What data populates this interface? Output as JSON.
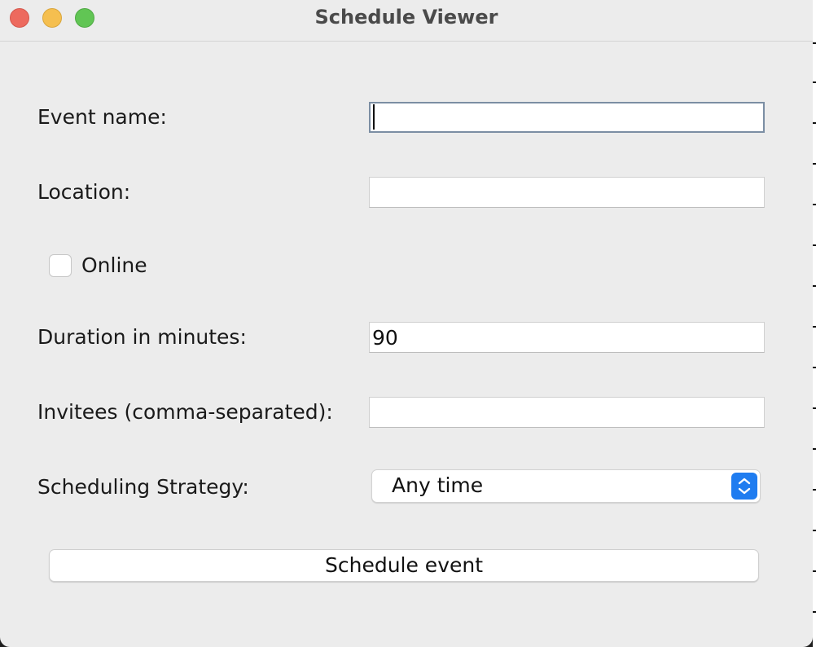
{
  "window": {
    "title": "Schedule Viewer"
  },
  "form": {
    "event_name": {
      "label": "Event name:",
      "value": ""
    },
    "location": {
      "label": "Location:",
      "value": ""
    },
    "online": {
      "label": "Online",
      "checked": false
    },
    "duration": {
      "label": "Duration in minutes:",
      "value": "90"
    },
    "invitees": {
      "label": "Invitees (comma-separated):",
      "value": ""
    },
    "strategy": {
      "label": "Scheduling Strategy:",
      "selected": "Any time"
    }
  },
  "actions": {
    "schedule_label": "Schedule event"
  },
  "colors": {
    "close": "#ed6a5e",
    "minimize": "#f5bf4f",
    "maximize": "#61c554",
    "accent": "#1f7cf0"
  }
}
